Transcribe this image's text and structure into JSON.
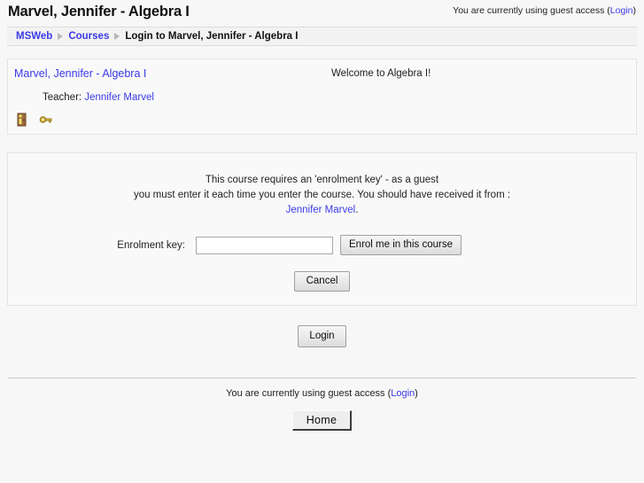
{
  "header": {
    "page_title": "Marvel, Jennifer - Algebra I",
    "guest_access_text": "You are currently using guest access (",
    "login_link": "Login",
    "guest_access_close": ")"
  },
  "breadcrumb": {
    "items": [
      {
        "label": "MSWeb",
        "type": "link"
      },
      {
        "label": "Courses",
        "type": "link"
      },
      {
        "label": "Login to Marvel, Jennifer - Algebra I",
        "type": "current"
      }
    ]
  },
  "course_box": {
    "course_name": "Marvel, Jennifer - Algebra I",
    "welcome_text": "Welcome to Algebra I!",
    "teacher_label": "Teacher:",
    "teacher_name": "Jennifer Marvel",
    "icons": [
      {
        "name": "course-info-icon",
        "title": "Course information"
      },
      {
        "name": "enrolment-key-icon",
        "title": "Enrolment key required"
      }
    ]
  },
  "enrolment": {
    "message_line1": "This course requires an 'enrolment key' - as a guest",
    "message_line2": "you must enter it each time you enter the course. You should have received it from :",
    "message_teacher": "Jennifer Marvel",
    "message_period": ".",
    "key_label": "Enrolment key:",
    "key_value": "",
    "key_placeholder": "",
    "submit_label": "Enrol me in this course",
    "cancel_label": "Cancel"
  },
  "login": {
    "login_label": "Login"
  },
  "footer": {
    "guest_access_text": "You are currently using guest access (",
    "login_link": "Login",
    "guest_access_close": ")",
    "home_label": "Home"
  },
  "colors": {
    "link": "#3a3ae8",
    "page_bg": "#f7f7f7",
    "box_bg": "#f9f9f9",
    "box_border": "#e4e4e4"
  }
}
